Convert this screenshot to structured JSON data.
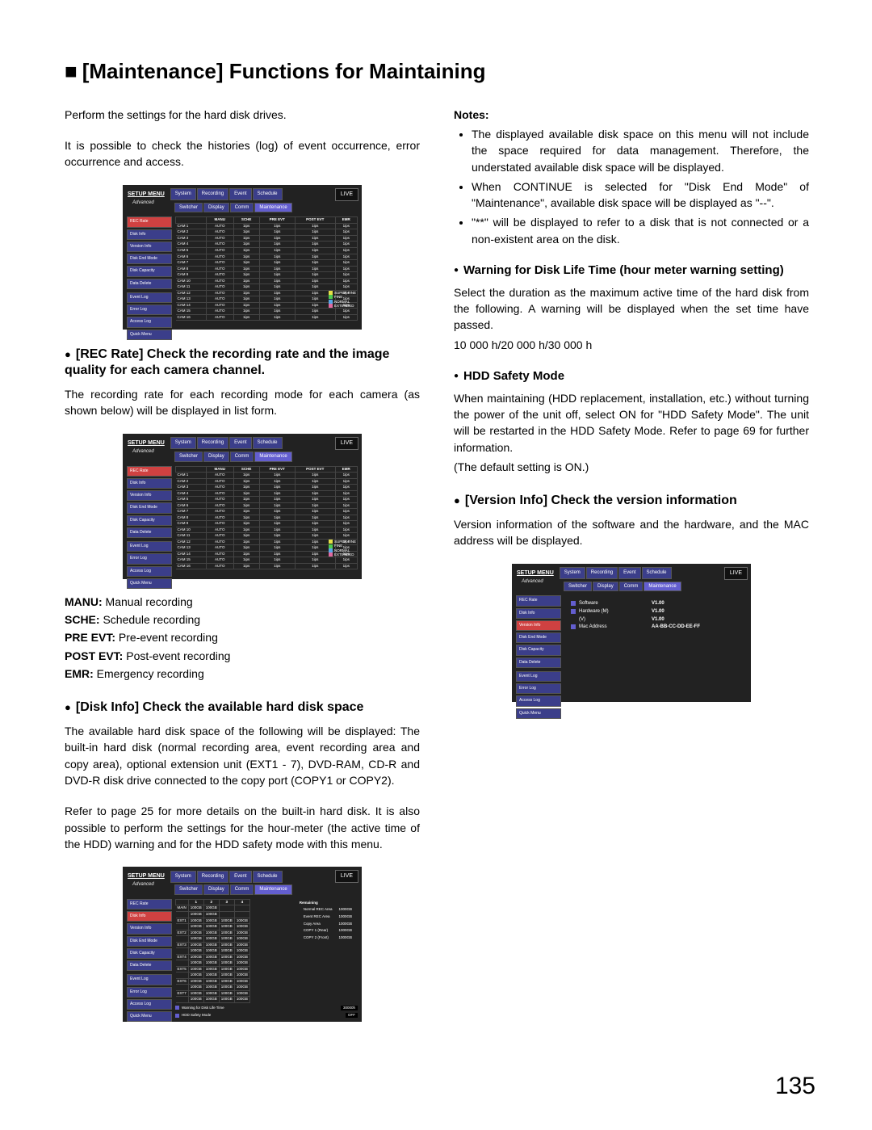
{
  "page_title": "[Maintenance] Functions for Maintaining",
  "intro_p1": "Perform the settings for the hard disk drives.",
  "intro_p2": "It is possible to check the histories (log) of event occurrence, error occurrence and access.",
  "rec_rate": {
    "heading": "[REC Rate] Check the recording rate and the image quality for each camera channel.",
    "body": "The recording rate for each recording mode for each camera (as shown below) will be displayed in list form."
  },
  "defs": {
    "manu": "Manual recording",
    "sche": "Schedule recording",
    "pre_evt": "Pre-event recording",
    "post_evt": "Post-event recording",
    "emr": "Emergency recording"
  },
  "disk_info": {
    "heading": "[Disk Info] Check the available hard disk space",
    "body1": "The available hard disk space of the following will be displayed: The built-in hard disk (normal recording area, event recording area and copy area), optional extension unit (EXT1 - 7), DVD-RAM, CD-R and DVD-R disk drive connected to the copy port (COPY1 or COPY2).",
    "body2": "Refer to page 25 for more details on the built-in hard disk. It is also possible to perform the settings for the hour-meter (the active time of the HDD) warning and for the HDD safety mode with this menu."
  },
  "notes": {
    "label": "Notes:",
    "items": [
      "The displayed available disk space on this menu will not include the space required for data management. Therefore, the understated available disk space will be displayed.",
      "When CONTINUE is selected for \"Disk End Mode\" of \"Maintenance\", available disk space will be displayed as \"--\".",
      "\"**\" will be displayed to refer to a disk that is not connected or a non-existent area on the disk."
    ]
  },
  "warning_section": {
    "heading": "Warning for Disk Life Time (hour meter warning setting)",
    "body": "Select the duration as the maximum active time of the hard disk from the following. A warning will be displayed when the set time have passed.",
    "values": "10 000 h/20 000 h/30 000 h"
  },
  "hdd_safety": {
    "heading": "HDD Safety Mode",
    "body": "When maintaining (HDD replacement, installation, etc.) without turning the power of the unit off, select ON for \"HDD Safety Mode\". The unit will be restarted in the HDD Safety Mode. Refer to page 69 for further information.",
    "default": "(The default setting is ON.)"
  },
  "version_info": {
    "heading": "[Version Info] Check the version information",
    "body": "Version information of the software and the hardware, and the MAC address will be displayed."
  },
  "panel_common": {
    "setup_menu": "SETUP MENU",
    "advanced": "Advanced",
    "tabs": [
      "System",
      "Recording",
      "Event",
      "Schedule"
    ],
    "subtabs": [
      "Switcher",
      "Display",
      "Comm",
      "Maintenance"
    ],
    "live": "LIVE",
    "sidenav": [
      "REC Rate",
      "Disk Info",
      "Version Info",
      "Disk End Mode",
      "Disk Capacity",
      "Data Delete",
      "Event Log",
      "Error Log",
      "Access Log",
      "Quick Menu"
    ]
  },
  "rec_panel": {
    "headers": [
      "",
      "MANU",
      "SCHE",
      "PRE EVT",
      "POST EVT",
      "EMR"
    ],
    "rows": [
      [
        "CAM 1",
        "AUTO",
        "1ips",
        "1ips",
        "1ips",
        "1ips"
      ],
      [
        "CAM 2",
        "AUTO",
        "1ips",
        "1ips",
        "1ips",
        "1ips"
      ],
      [
        "CAM 3",
        "AUTO",
        "1ips",
        "1ips",
        "1ips",
        "1ips"
      ],
      [
        "CAM 4",
        "AUTO",
        "1ips",
        "1ips",
        "1ips",
        "1ips"
      ],
      [
        "CAM 5",
        "AUTO",
        "1ips",
        "1ips",
        "1ips",
        "1ips"
      ],
      [
        "CAM 6",
        "AUTO",
        "1ips",
        "1ips",
        "1ips",
        "1ips"
      ],
      [
        "CAM 7",
        "AUTO",
        "1ips",
        "1ips",
        "1ips",
        "1ips"
      ],
      [
        "CAM 8",
        "AUTO",
        "1ips",
        "1ips",
        "1ips",
        "1ips"
      ],
      [
        "CAM 9",
        "AUTO",
        "1ips",
        "1ips",
        "1ips",
        "1ips"
      ],
      [
        "CAM 10",
        "AUTO",
        "1ips",
        "1ips",
        "1ips",
        "1ips"
      ],
      [
        "CAM 11",
        "AUTO",
        "1ips",
        "1ips",
        "1ips",
        "1ips"
      ],
      [
        "CAM 12",
        "AUTO",
        "1ips",
        "1ips",
        "1ips",
        "1ips"
      ],
      [
        "CAM 13",
        "AUTO",
        "1ips",
        "1ips",
        "1ips",
        "1ips"
      ],
      [
        "CAM 14",
        "AUTO",
        "1ips",
        "1ips",
        "1ips",
        "1ips"
      ],
      [
        "CAM 15",
        "AUTO",
        "1ips",
        "1ips",
        "1ips",
        "1ips"
      ],
      [
        "CAM 16",
        "AUTO",
        "1ips",
        "1ips",
        "1ips",
        "1ips"
      ]
    ],
    "legend": [
      {
        "color": "#e5e047",
        "label": "SUPER FINE"
      },
      {
        "color": "#4fc94f",
        "label": "FINE"
      },
      {
        "color": "#56a7e6",
        "label": "NORMAL"
      },
      {
        "color": "#e06aa0",
        "label": "EXTENDED"
      }
    ]
  },
  "disk_panel": {
    "col_headers": [
      "",
      "1",
      "2",
      "3",
      "4"
    ],
    "rows": [
      [
        "MAIN",
        "100GB",
        "100GB",
        "",
        ""
      ],
      [
        "",
        "100GB",
        "100GB",
        "",
        ""
      ],
      [
        "EXT1",
        "100GB",
        "100GB",
        "100GB",
        "100GB"
      ],
      [
        "",
        "100GB",
        "100GB",
        "100GB",
        "100GB"
      ],
      [
        "EXT2",
        "100GB",
        "100GB",
        "100GB",
        "100GB"
      ],
      [
        "",
        "100GB",
        "100GB",
        "100GB",
        "100GB"
      ],
      [
        "EXT3",
        "100GB",
        "100GB",
        "100GB",
        "100GB"
      ],
      [
        "",
        "100GB",
        "100GB",
        "100GB",
        "100GB"
      ],
      [
        "EXT4",
        "100GB",
        "100GB",
        "100GB",
        "100GB"
      ],
      [
        "",
        "100GB",
        "100GB",
        "100GB",
        "100GB"
      ],
      [
        "EXT5",
        "100GB",
        "100GB",
        "100GB",
        "100GB"
      ],
      [
        "",
        "100GB",
        "100GB",
        "100GB",
        "100GB"
      ],
      [
        "EXT6",
        "100GB",
        "100GB",
        "100GB",
        "100GB"
      ],
      [
        "",
        "100GB",
        "100GB",
        "100GB",
        "100GB"
      ],
      [
        "EXT7",
        "100GB",
        "100GB",
        "100GB",
        "100GB"
      ],
      [
        "",
        "100GB",
        "100GB",
        "100GB",
        "100GB"
      ]
    ],
    "remaining": {
      "label": "Remaining",
      "rows": [
        [
          "Normal REC Area",
          "1000GB"
        ],
        [
          "Event REC Area",
          "1000GB"
        ],
        [
          "Copy Area",
          "1000GB"
        ],
        [
          "COPY 1 (Rear)",
          "1000GB"
        ],
        [
          "COPY 2 (Front)",
          "1000GB"
        ]
      ]
    },
    "warning_label": "Warning for Disk Life Time",
    "warning_value": "30000h",
    "safety_label": "HDD Safety Mode",
    "safety_value": "OFF"
  },
  "version_panel": {
    "rows": [
      {
        "label": "Software",
        "value": "V1.00"
      },
      {
        "label": "Hardware (M)",
        "value": "V1.00"
      },
      {
        "label": "(V)",
        "value": "V1.00"
      },
      {
        "label": "Mac Address",
        "value": "AA-BB-CC-DD-EE-FF"
      }
    ]
  },
  "page_number": "135"
}
